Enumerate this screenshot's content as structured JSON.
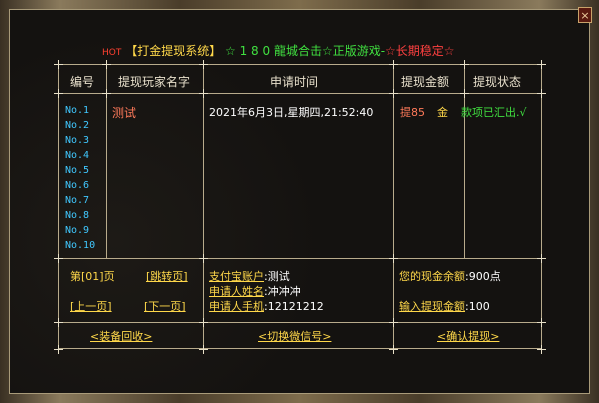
{
  "title": {
    "hot": "HOT",
    "system": "【打金提现系统】",
    "banner_green": "☆ 1 8 0 龍城合击☆正版游戏-",
    "banner_red": "☆长期稳定☆"
  },
  "close_label": "×",
  "headers": [
    "编号",
    "提现玩家名字",
    "申请时间",
    "提现金额",
    "提现状态"
  ],
  "rows": [
    "No.1",
    "No.2",
    "No.3",
    "No.4",
    "No.5",
    "No.6",
    "No.7",
    "No.8",
    "No.9",
    "No.10"
  ],
  "record": {
    "player": "测试",
    "time": "2021年6月3日,星期四,21:52:40",
    "amount": "提85",
    "currency": "金",
    "status": "款项已汇出.√"
  },
  "pager": {
    "page": "第[01]页",
    "jump": "[跳转页]",
    "prev": "[上一页]",
    "next": "[下一页]"
  },
  "account": {
    "alipay_label": "支付宝账户",
    "alipay_value": ":测试",
    "name_label": "申请人姓名",
    "name_value": ":冲冲冲",
    "phone_label": "申请人手机",
    "phone_value": ":12121212"
  },
  "balance": {
    "label": "您的现金余额",
    "value": ":900点",
    "input_label": "输入提现金额",
    "input_value": ":100"
  },
  "actions": {
    "recycle": "<装备回收>",
    "switch_wechat": "<切换微信号>",
    "confirm": "<确认提现>"
  },
  "colors": {
    "yellow": "#ffd84a",
    "row_number": "#40c8ff",
    "player": "#ff7a5a",
    "status": "#40e040",
    "amount": "#ff7a5a"
  }
}
